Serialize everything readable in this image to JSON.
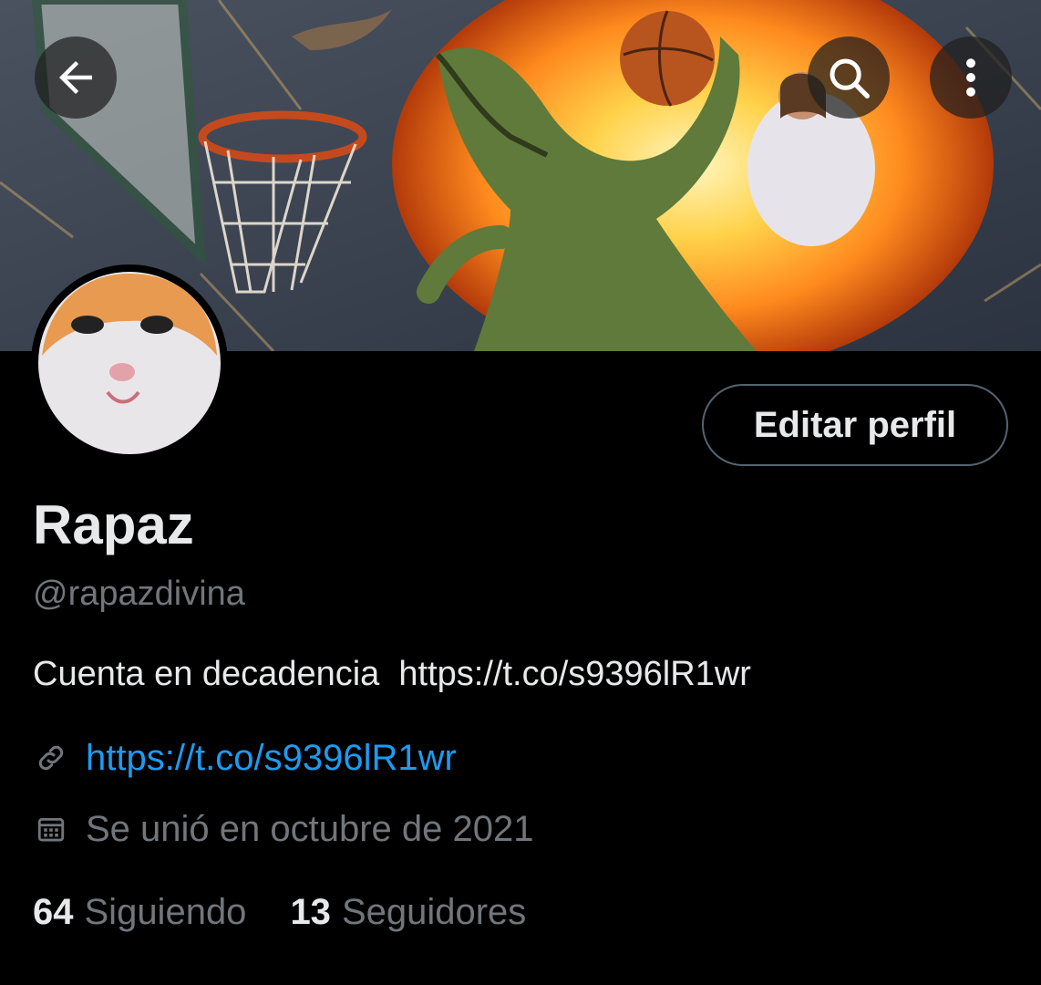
{
  "header": {
    "back_icon": "arrow-left-icon",
    "search_icon": "search-icon",
    "more_icon": "more-vertical-icon"
  },
  "banner": {
    "description_icon": "banner-image"
  },
  "profile": {
    "edit_label": "Editar perfil",
    "name": "Rapaz",
    "handle": "@rapazdivina",
    "bio": "Cuenta en decadencia  https://t.co/s9396lR1wr",
    "link": "https://t.co/s9396lR1wr",
    "joined": "Se unió en octubre de 2021",
    "following_count": "64",
    "following_label": "Siguiendo",
    "followers_count": "13",
    "followers_label": "Seguidores"
  },
  "colors": {
    "background": "#000000",
    "text_primary": "#e7e9ea",
    "text_secondary": "#71767b",
    "link": "#1d9bf0",
    "border": "#536471"
  }
}
